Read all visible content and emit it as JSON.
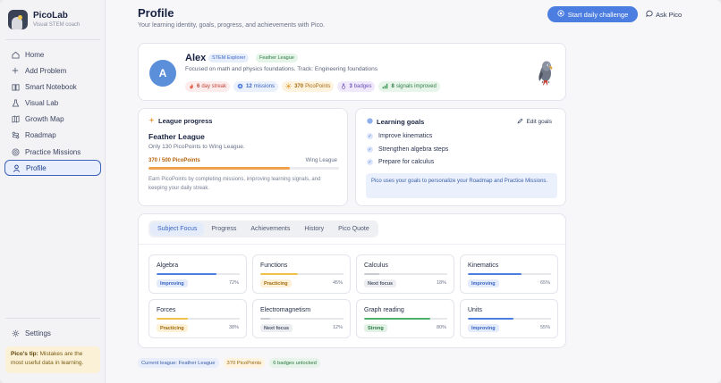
{
  "app": {
    "name": "PicoLab",
    "tagline": "Visual STEM coach"
  },
  "sidebar": {
    "items": [
      {
        "label": "Home",
        "icon": "home-icon"
      },
      {
        "label": "Add Problem",
        "icon": "plus-icon"
      },
      {
        "label": "Smart Notebook",
        "icon": "book-icon"
      },
      {
        "label": "Visual Lab",
        "icon": "flask-icon"
      },
      {
        "label": "Growth Map",
        "icon": "map-icon"
      },
      {
        "label": "Roadmap",
        "icon": "route-icon"
      },
      {
        "label": "Practice Missions",
        "icon": "target-icon"
      },
      {
        "label": "Profile",
        "icon": "user-icon",
        "active": true
      }
    ],
    "settings_label": "Settings",
    "tip_title": "Pico's tip:",
    "tip_text": "Mistakes are the most useful data in learning."
  },
  "header": {
    "title": "Profile",
    "subtitle": "Your learning identity, goals, progress, and achievements with Pico.",
    "primary_button": "Start daily challenge",
    "secondary_button": "Ask Pico"
  },
  "profile": {
    "avatar_initial": "A",
    "name": "Alex",
    "tag_explorer": "STEM Explorer",
    "tag_league": "Feather League",
    "focus": "Focused on math and physics foundations. Track: Engineering foundations",
    "stats": {
      "streak_value": "6",
      "streak_label": "day streak",
      "missions_value": "12",
      "missions_label": "missions",
      "points_value": "370",
      "points_label": "PicoPoints",
      "badges_value": "3",
      "badges_label": "badges",
      "signals_value": "8",
      "signals_label": "signals improved"
    }
  },
  "league": {
    "heading": "League progress",
    "name": "Feather League",
    "subtitle": "Only 130 PicoPoints to Wing League.",
    "points_text": "370 / 500 PicoPoints",
    "next_league": "Wing League",
    "progress": 0.74,
    "note": "Earn PicoPoints by completing missions, improving learning signals, and keeping your daily streak."
  },
  "goals": {
    "heading": "Learning goals",
    "edit_label": "Edit goals",
    "items": [
      "Improve kinematics",
      "Strengthen algebra steps",
      "Prepare for calculus"
    ],
    "note": "Pico uses your goals to personalize your Roadmap and Practice Missions."
  },
  "tabs": [
    {
      "label": "Subject Focus",
      "active": true
    },
    {
      "label": "Progress"
    },
    {
      "label": "Achievements"
    },
    {
      "label": "History"
    },
    {
      "label": "Pico Quote"
    }
  ],
  "subjects": [
    {
      "name": "Algebra",
      "status": "Improving",
      "percent": 72,
      "color": "#4c7de0"
    },
    {
      "name": "Functions",
      "status": "Practicing",
      "percent": 45,
      "color": "#f0c14a"
    },
    {
      "name": "Calculus",
      "status": "Next focus",
      "percent": 18,
      "color": "#c9cbd2"
    },
    {
      "name": "Kinematics",
      "status": "Improving",
      "percent": 65,
      "color": "#4c7de0"
    },
    {
      "name": "Forces",
      "status": "Practicing",
      "percent": 38,
      "color": "#f0c14a"
    },
    {
      "name": "Electromagnetism",
      "status": "Next focus",
      "percent": 12,
      "color": "#c9cbd2"
    },
    {
      "name": "Graph reading",
      "status": "Strong",
      "percent": 80,
      "color": "#4caf6a"
    },
    {
      "name": "Units",
      "status": "Improving",
      "percent": 55,
      "color": "#4c7de0"
    }
  ],
  "footer": {
    "league_tag": "Current league: Feather League",
    "points_tag": "370 PicoPoints",
    "badges_tag": "6 badges unlocked"
  }
}
